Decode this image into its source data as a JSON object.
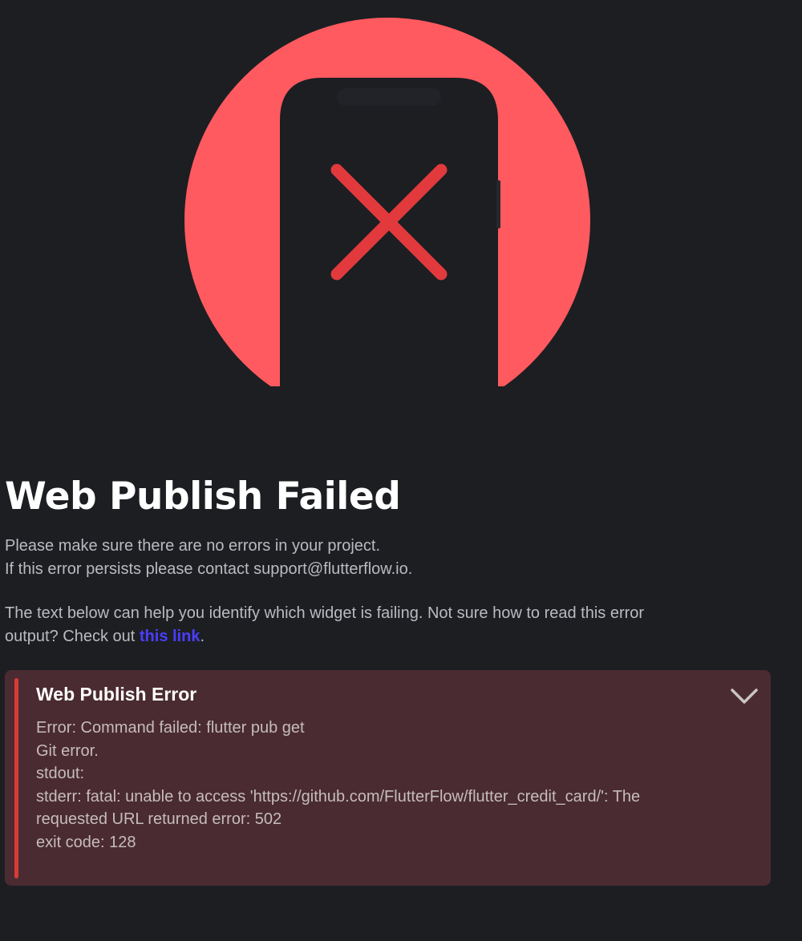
{
  "colors": {
    "background": "#1c1e22",
    "circle": "#ff5a5f",
    "phone": "#1c1e22",
    "x_mark": "#e23a3c",
    "link": "#4b3dff",
    "panel": "#4a2b31",
    "panel_accent": "#d83a34"
  },
  "hero": {
    "icon": "phone-error-x-icon"
  },
  "title": "Web Publish Failed",
  "description": {
    "line1": "Please make sure there are no errors in your project.",
    "line2": "If this error persists please contact support@flutterflow.io.",
    "help_text_line1": "The text below can help you identify which widget is failing. Not sure how to read this error",
    "help_text_line2_prefix": "output? Check out ",
    "link_text": "this link",
    "help_text_line2_suffix": "."
  },
  "error_panel": {
    "title": "Web Publish Error",
    "toggle_icon": "chevron-down-icon",
    "lines": [
      "Error: Command failed: flutter pub get",
      "Git error.",
      "stdout:",
      "stderr: fatal: unable to access 'https://github.com/FlutterFlow/flutter_credit_card/': The",
      "requested URL returned error: 502",
      "exit code: 128"
    ]
  }
}
